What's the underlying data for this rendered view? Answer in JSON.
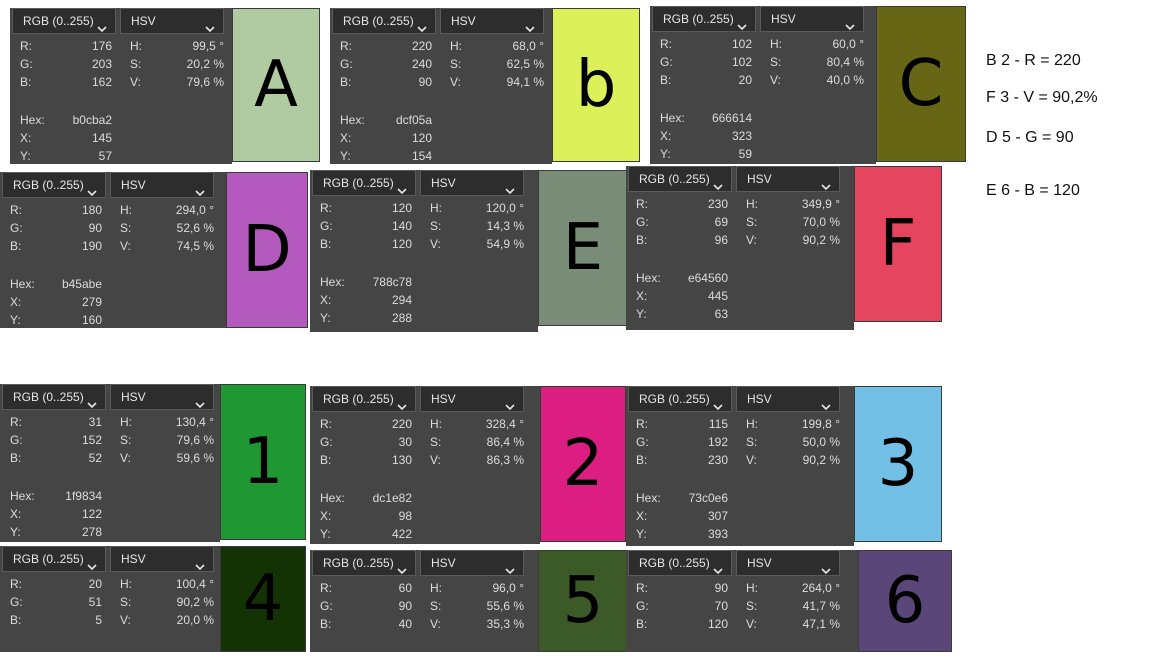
{
  "panels": [
    {
      "id": "A",
      "mode": "RGB (0..255)",
      "space": "HSV",
      "R": "176",
      "G": "203",
      "B": "162",
      "H": "99,5 °",
      "S": "20,2 %",
      "V": "79,6 %",
      "hex": "b0cba2",
      "x": "145",
      "y": "57",
      "label": "A",
      "color": "#b0cba2"
    },
    {
      "id": "B",
      "mode": "RGB (0..255)",
      "space": "HSV",
      "R": "220",
      "G": "240",
      "B": "90",
      "H": "68,0 °",
      "S": "62,5 %",
      "V": "94,1 %",
      "hex": "dcf05a",
      "x": "120",
      "y": "154",
      "label": "b",
      "color": "#dcf05a"
    },
    {
      "id": "C",
      "mode": "RGB (0..255)",
      "space": "HSV",
      "R": "102",
      "G": "102",
      "B": "20",
      "H": "60,0 °",
      "S": "80,4 %",
      "V": "40,0 %",
      "hex": "666614",
      "x": "323",
      "y": "59",
      "label": "C",
      "color": "#666614"
    },
    {
      "id": "D",
      "mode": "RGB (0..255)",
      "space": "HSV",
      "R": "180",
      "G": "90",
      "B": "190",
      "H": "294,0 °",
      "S": "52,6 %",
      "V": "74,5 %",
      "hex": "b45abe",
      "x": "279",
      "y": "160",
      "label": "D",
      "color": "#b45abe"
    },
    {
      "id": "E",
      "mode": "RGB (0..255)",
      "space": "HSV",
      "R": "120",
      "G": "140",
      "B": "120",
      "H": "120,0 °",
      "S": "14,3 %",
      "V": "54,9 %",
      "hex": "788c78",
      "x": "294",
      "y": "288",
      "label": "E",
      "color": "#788c78"
    },
    {
      "id": "F",
      "mode": "RGB (0..255)",
      "space": "HSV",
      "R": "230",
      "G": "69",
      "B": "96",
      "H": "349,9 °",
      "S": "70,0 %",
      "V": "90,2 %",
      "hex": "e64560",
      "x": "445",
      "y": "63",
      "label": "F",
      "color": "#e64560"
    },
    {
      "id": "1",
      "mode": "RGB (0..255)",
      "space": "HSV",
      "R": "31",
      "G": "152",
      "B": "52",
      "H": "130,4 °",
      "S": "79,6 %",
      "V": "59,6 %",
      "hex": "1f9834",
      "x": "122",
      "y": "278",
      "label": "1",
      "color": "#1f9834"
    },
    {
      "id": "2",
      "mode": "RGB (0..255)",
      "space": "HSV",
      "R": "220",
      "G": "30",
      "B": "130",
      "H": "328,4 °",
      "S": "86,4 %",
      "V": "86,3 %",
      "hex": "dc1e82",
      "x": "98",
      "y": "422",
      "label": "2",
      "color": "#dc1e82"
    },
    {
      "id": "3",
      "mode": "RGB (0..255)",
      "space": "HSV",
      "R": "115",
      "G": "192",
      "B": "230",
      "H": "199,8 °",
      "S": "50,0 %",
      "V": "90,2 %",
      "hex": "73c0e6",
      "x": "307",
      "y": "393",
      "label": "3",
      "color": "#73c0e6"
    },
    {
      "id": "4",
      "mode": "RGB (0..255)",
      "space": "HSV",
      "R": "20",
      "G": "51",
      "B": "5",
      "H": "100,4 °",
      "S": "90,2 %",
      "V": "20,0 %",
      "label": "4",
      "color": "#143305"
    },
    {
      "id": "5",
      "mode": "RGB (0..255)",
      "space": "HSV",
      "R": "60",
      "G": "90",
      "B": "40",
      "H": "96,0 °",
      "S": "55,6 %",
      "V": "35,3 %",
      "label": "5",
      "color": "#3c5a28"
    },
    {
      "id": "6",
      "mode": "RGB (0..255)",
      "space": "HSV",
      "R": "90",
      "G": "70",
      "B": "120",
      "H": "264,0 °",
      "S": "41,7 %",
      "V": "47,1 %",
      "label": "6",
      "color": "#5a4678"
    }
  ],
  "labels": {
    "R": "R:",
    "G": "G:",
    "B": "B:",
    "H": "H:",
    "S": "S:",
    "V": "V:",
    "hex": "Hex:",
    "x": "X:",
    "y": "Y:"
  },
  "notes": [
    "B 2 - R = 220",
    "F 3 - V = 90,2%",
    "D 5 - G = 90",
    "E 6 - B = 120"
  ]
}
